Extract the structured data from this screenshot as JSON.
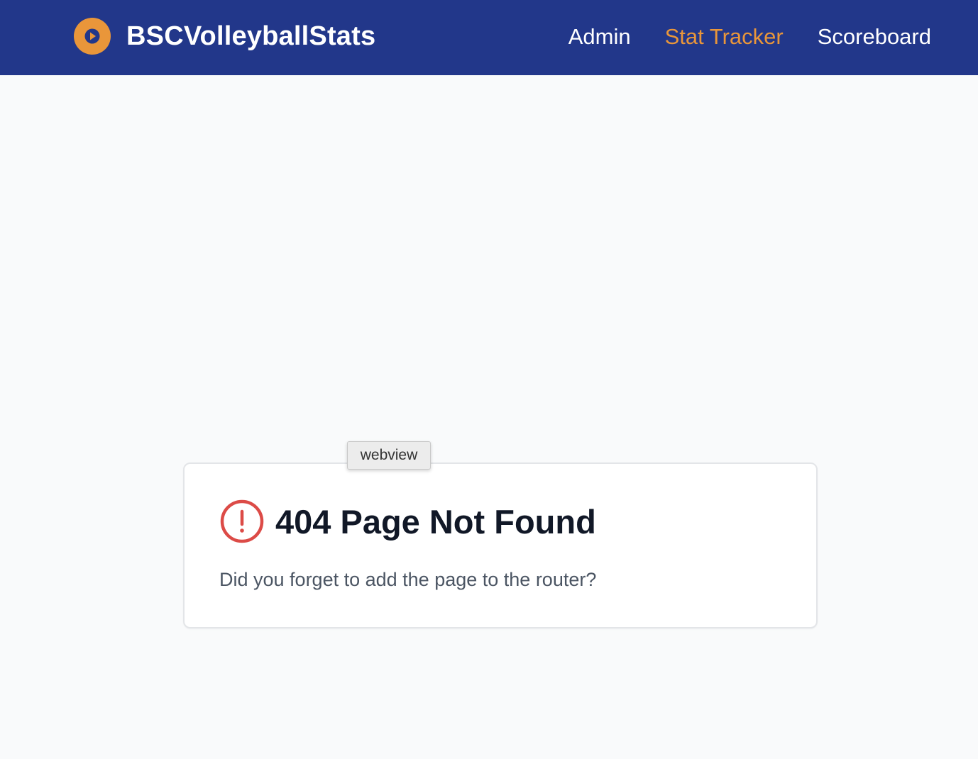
{
  "navbar": {
    "brand_name": "BSCVolleyballStats",
    "brand_icon": "play-circle-icon",
    "links": [
      {
        "label": "Admin",
        "active": false
      },
      {
        "label": "Stat Tracker",
        "active": true
      },
      {
        "label": "Scoreboard",
        "active": false
      }
    ],
    "colors": {
      "background": "#22378a",
      "link": "#ffffff",
      "active_link": "#e9963a",
      "logo": "#e9963a"
    }
  },
  "error_card": {
    "icon": "alert-circle-icon",
    "title": "404 Page Not Found",
    "message": "Did you forget to add the page to the router?",
    "icon_color": "#dc4b47"
  },
  "tooltip": {
    "text": "webview"
  }
}
